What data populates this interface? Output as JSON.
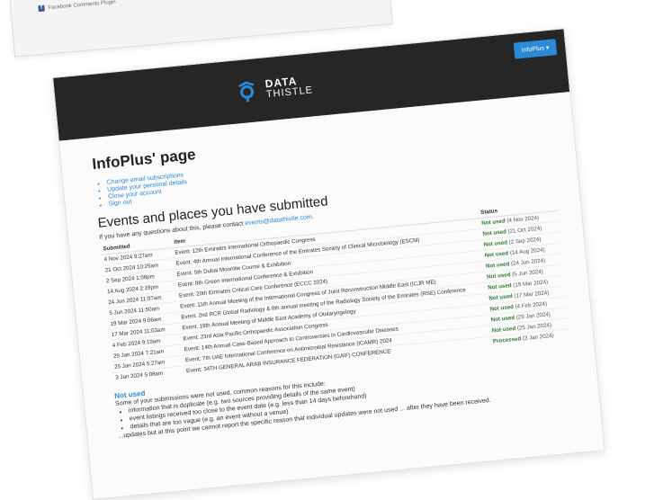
{
  "background_window": {
    "plugin_label": "Facebook Comments Plugin"
  },
  "header": {
    "logo_line1": "DATA",
    "logo_line2": "THISTLE",
    "user_button": "InfoPlus",
    "user_caret": "▾"
  },
  "page_title": "InfoPlus' page",
  "account_links": [
    "Change email subscriptions",
    "Update your personal details",
    "Close your account",
    "Sign out"
  ],
  "events_title": "Events and places you have submitted",
  "contact_note_prefix": "If you have any questions about this, please contact",
  "contact_email": "events@datathistle.com",
  "table": {
    "headers": [
      "Submitted",
      "Item",
      "Status"
    ],
    "rows": [
      {
        "submitted": "4 Nov 2024 9:27am",
        "item": "Event: 12th Emirates International Orthopaedic Congress",
        "status": "Not used",
        "date": "(4 Nov 2024)"
      },
      {
        "submitted": "21 Oct 2024 10:25am",
        "item": "Event: 4th Annual International Conference of the Emirates Society of Clinical Microbiology (ESCM)",
        "status": "Not used",
        "date": "(21 Oct 2024)"
      },
      {
        "submitted": "2 Sep 2024 1:08pm",
        "item": "Event: 5th Dubai Moonlite Course & Exhibition",
        "status": "Not used",
        "date": "(2 Sep 2024)"
      },
      {
        "submitted": "14 Aug 2024 2:19pm",
        "item": "Event: 8th Green International Conference & Exhibition",
        "status": "Not used",
        "date": "(14 Aug 2024)"
      },
      {
        "submitted": "24 Jun 2024 11:07am",
        "item": "Event: 20th Emirates Critical Care Conference (ECCC 2024)",
        "status": "Not used",
        "date": "(24 Jun 2024)"
      },
      {
        "submitted": "5 Jun 2024 11:50am",
        "item": "Event: 11th Annual Meeting of the International Congress of Joint Reconstruction Middle East (ICJR ME)",
        "status": "Not used",
        "date": "(5 Jun 2024)"
      },
      {
        "submitted": "19 Mar 2024 9:06am",
        "item": "Event: 2nd RCR Global Radiology & 8th annual meeting of the Radiology Society of the Emirates (RSE) Conference",
        "status": "Not used",
        "date": "(19 Mar 2024)"
      },
      {
        "submitted": "17 Mar 2024 11:03am",
        "item": "Event: 19th Annual Meeting of Middle East Academy of Otolaryngology",
        "status": "Not used",
        "date": "(17 Mar 2024)"
      },
      {
        "submitted": "4 Feb 2024 9:19am",
        "item": "Event: 23rd Asia Pacific Orthopaedic Association Congress",
        "status": "Not used",
        "date": "(4 Feb 2024)"
      },
      {
        "submitted": "29 Jan 2024 7:21am",
        "item": "Event: 14th Annual Case-Based Approach to Controversies in Cardiovascular Diseases",
        "status": "Not used",
        "date": "(29 Jan 2024)"
      },
      {
        "submitted": "25 Jan 2024 5:27am",
        "item": "Event: 7th UAE International Conference on Antimicrobial Resistance (ICAMR) 2024",
        "status": "Not used",
        "date": "(25 Jan 2024)"
      },
      {
        "submitted": "3 Jan 2024 5:08am",
        "item": "Event: 34TH GENERAL ARAB INSURANCE FEDERATION (GAIF) CONFERENCE",
        "status": "Processed",
        "date": "(3 Jan 2024)"
      }
    ]
  },
  "not_used": {
    "title": "Not used",
    "intro": "Some of your submissions were not used, common reasons for this include:",
    "reasons": [
      "information that is duplicate (e.g. two sources providing details of the same event)",
      "event listings received too close to the event date (e.g. less than 14 days beforehand)",
      "details that are too vague (e.g. an event without a venue)"
    ],
    "footer": "...updates but at this point we cannot report the specific reason that individual updates were not used ... after they have been received."
  }
}
